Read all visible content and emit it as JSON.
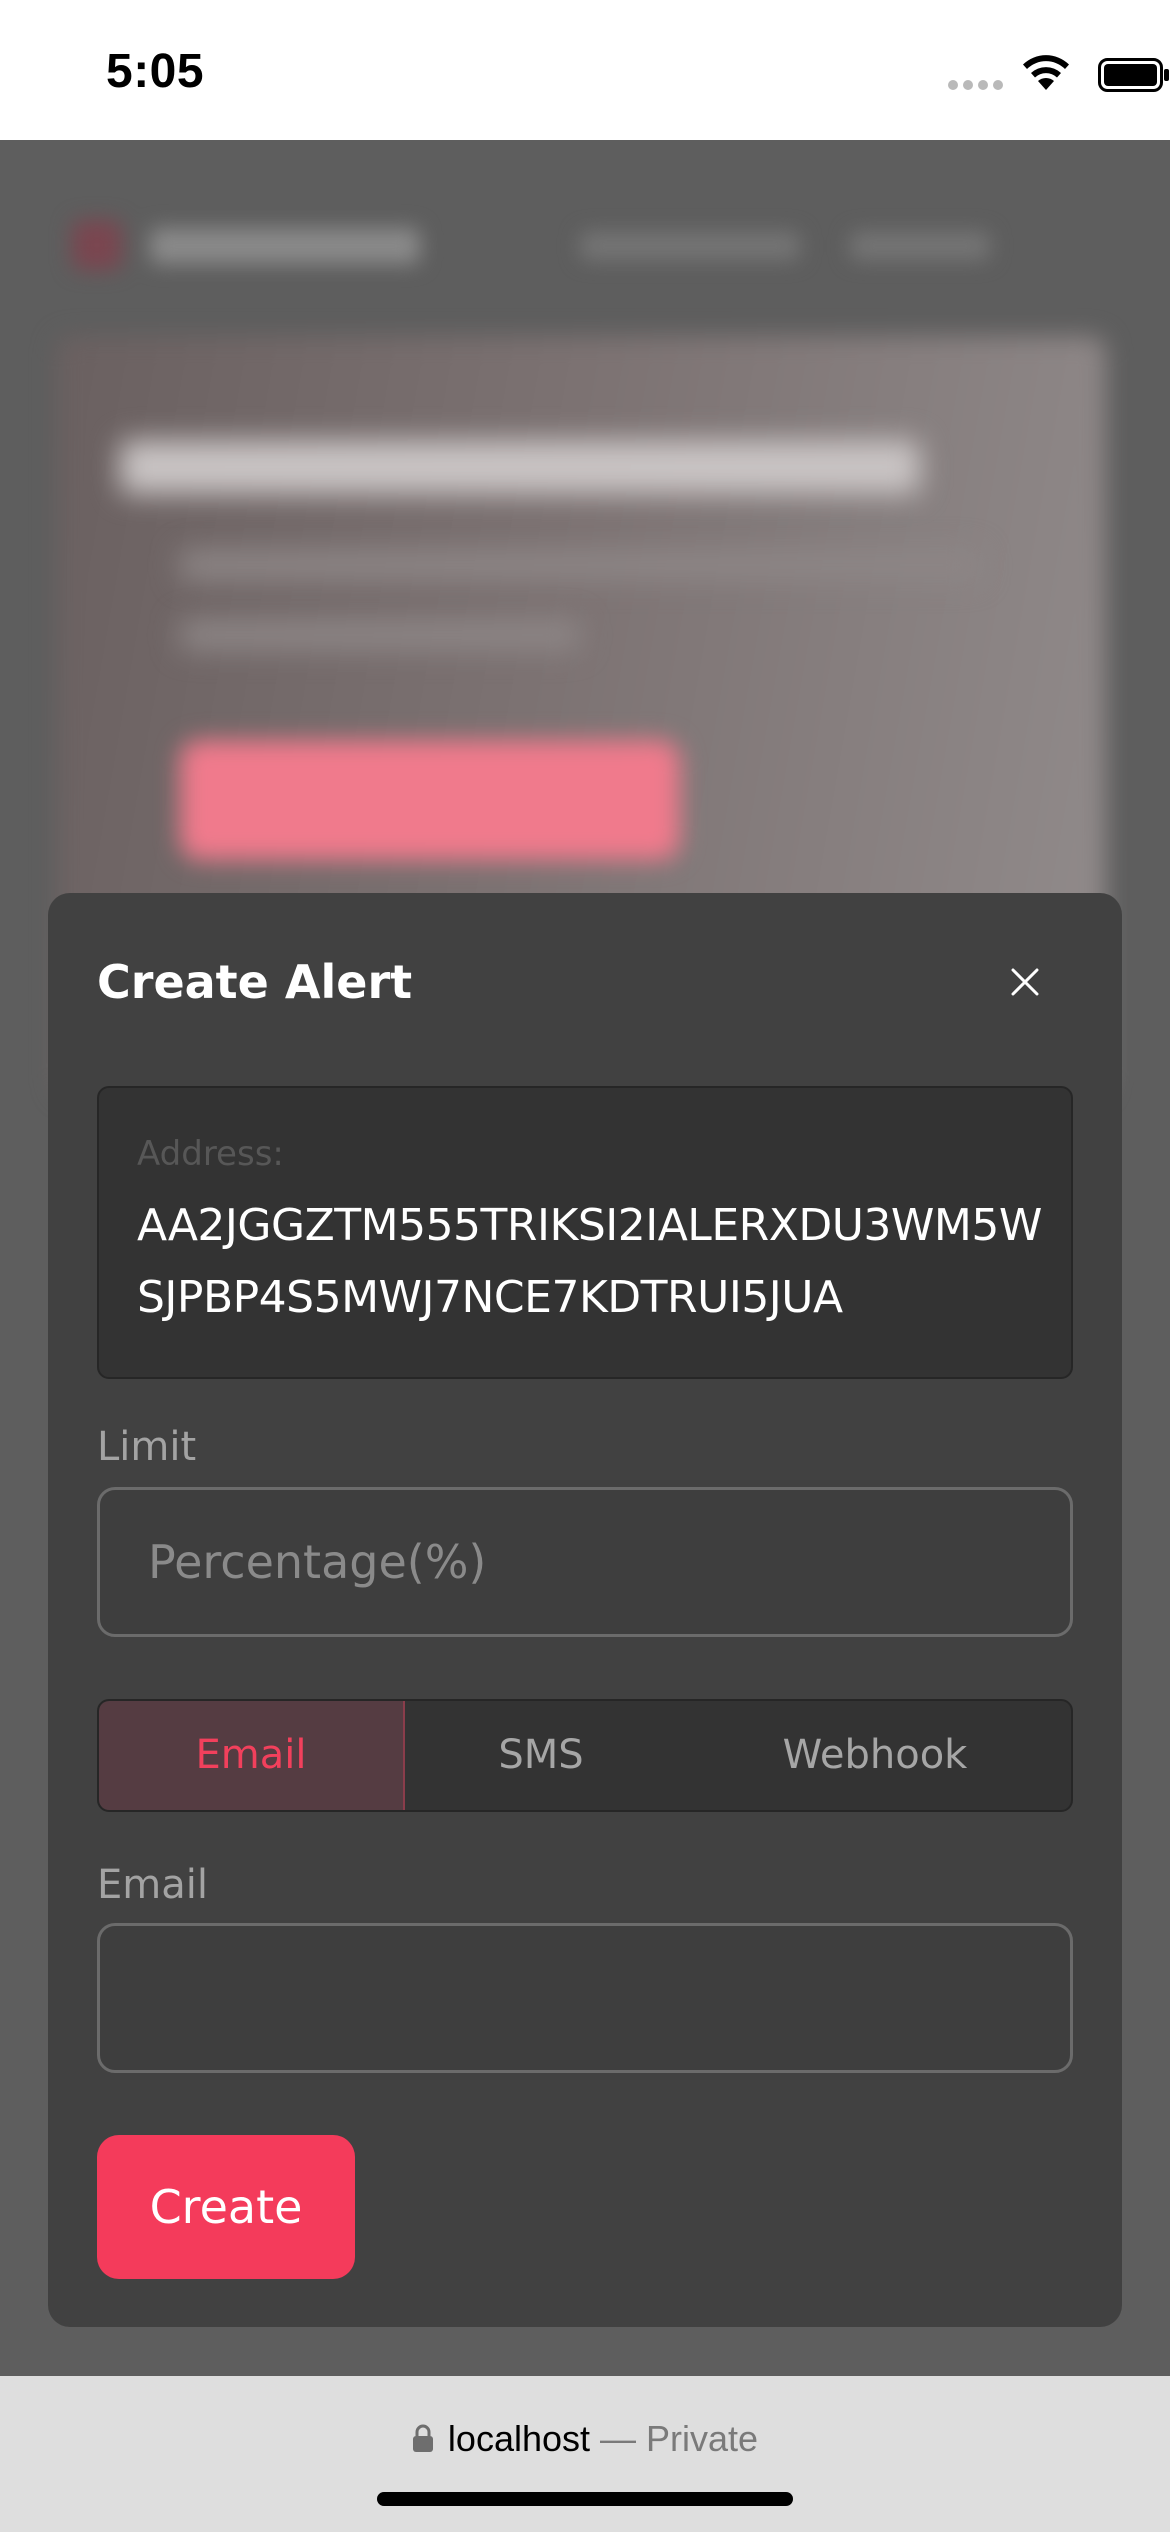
{
  "status_bar": {
    "time": "5:05",
    "icons": [
      "cellular-signal-icon",
      "wifi-icon",
      "battery-icon"
    ]
  },
  "modal": {
    "title": "Create Alert",
    "close_icon": "close-icon",
    "address": {
      "label": "Address:",
      "value": "AA2JGGZTM555TRIKSI2IALERXDU3WM5WSJPBP4S5MWJ7NCE7KDTRUI5JUA"
    },
    "limit": {
      "label": "Limit",
      "placeholder": "Percentage(%)",
      "value": ""
    },
    "channel_tabs": [
      {
        "label": "Email",
        "selected": true
      },
      {
        "label": "SMS",
        "selected": false
      },
      {
        "label": "Webhook",
        "selected": false
      }
    ],
    "email": {
      "label": "Email",
      "value": ""
    },
    "create_label": "Create"
  },
  "browser": {
    "host": "localhost",
    "mode": "— Private"
  },
  "colors": {
    "accent": "#f43b5b",
    "modal_bg": "#414141",
    "selected_tab_bg": "#553c42"
  }
}
